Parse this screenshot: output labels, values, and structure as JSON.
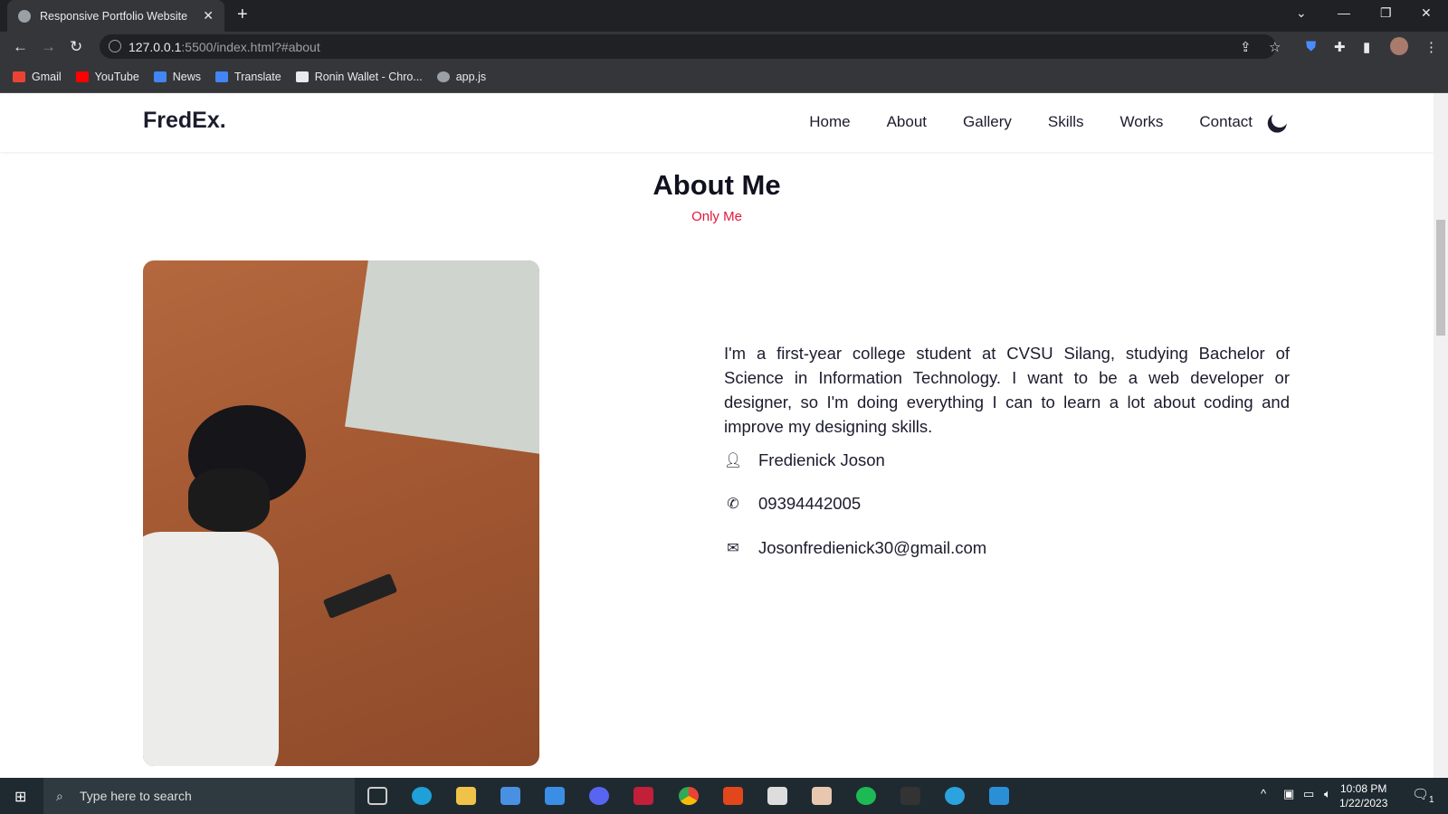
{
  "browser": {
    "tab_title": "Responsive Portfolio Website",
    "url_host": "127.0.0.1",
    "url_rest": ":5500/index.html?#about",
    "bookmarks": [
      {
        "label": "Gmail",
        "color": "#ea4335"
      },
      {
        "label": "YouTube",
        "color": "#ff0000"
      },
      {
        "label": "News",
        "color": "#4285f4"
      },
      {
        "label": "Translate",
        "color": "#4285f4"
      },
      {
        "label": "Ronin Wallet - Chro...",
        "color": "#e8eaed"
      },
      {
        "label": "app.js",
        "color": "#9aa0a6"
      }
    ]
  },
  "site": {
    "logo": "FredEx.",
    "nav": [
      "Home",
      "About",
      "Gallery",
      "Skills",
      "Works",
      "Contact"
    ],
    "section_title": "About Me",
    "section_subtitle": "Only Me",
    "description": "I'm a first-year college student at CVSU Silang, studying Bachelor of Science in Information Technology. I want to be a web developer or designer, so I'm doing everything I can to learn a lot about coding and improve my designing skills.",
    "name": "Fredienick Joson",
    "phone": "09394442005",
    "email": "Josonfredienick30@gmail.com",
    "accent": "#e1163c"
  },
  "taskbar": {
    "search_placeholder": "Type here to search",
    "time": "10:08 PM",
    "date": "1/22/2023",
    "notifications": "1"
  }
}
